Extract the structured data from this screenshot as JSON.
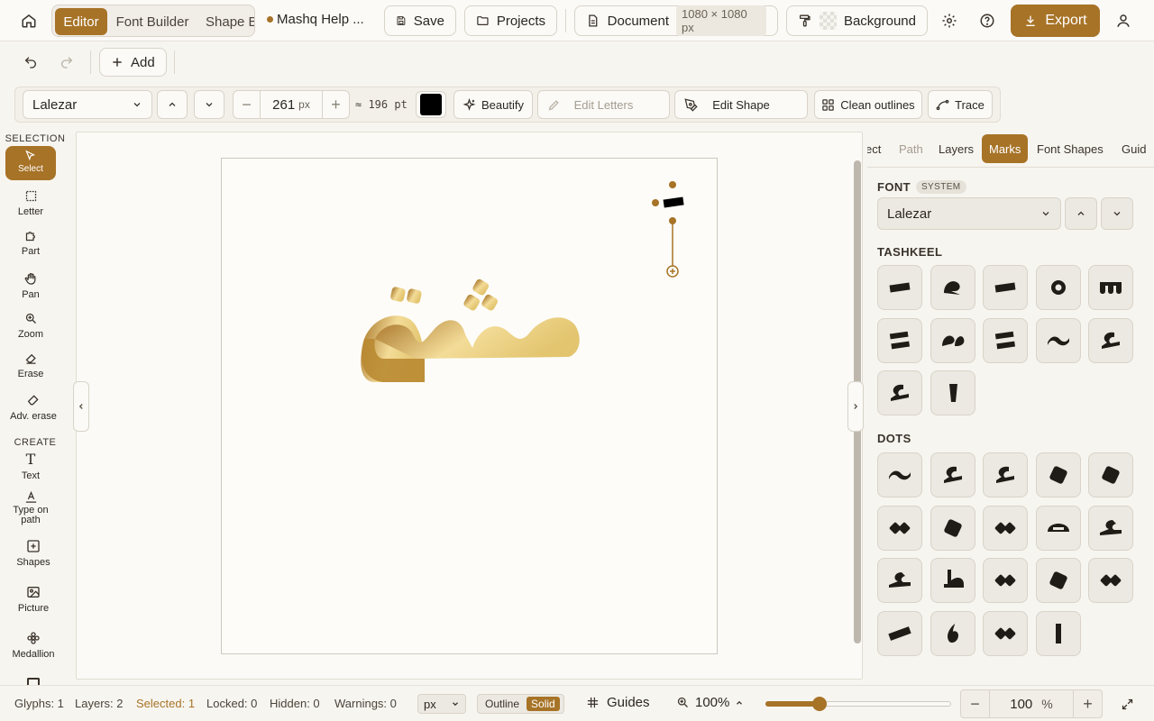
{
  "topbar": {
    "tabs": [
      {
        "label": "Editor"
      },
      {
        "label": "Font Builder"
      },
      {
        "label": "Shape Builder"
      }
    ],
    "help_label": "Mashq Help ...",
    "save_label": "Save",
    "projects_label": "Projects",
    "document_label": "Document",
    "document_size": "1080 × 1080 px",
    "background_label": "Background",
    "export_label": "Export"
  },
  "row2": {
    "add_label": "Add"
  },
  "toolbar": {
    "font_value": "Lalezar",
    "size_value": "261",
    "size_unit": "px",
    "size_pt": "≈ 196 pt",
    "color_value": "#000000",
    "beautify_label": "Beautify",
    "edit_letters_label": "Edit Letters",
    "edit_shape_label": "Edit Shape",
    "clean_outlines_label": "Clean outlines",
    "trace_label": "Trace"
  },
  "sidebar": {
    "selection_heading": "SELECTION",
    "create_heading": "CREATE",
    "tools": [
      {
        "label": "Select"
      },
      {
        "label": "Letter"
      },
      {
        "label": "Part"
      },
      {
        "label": "Pan"
      },
      {
        "label": "Zoom"
      },
      {
        "label": "Erase"
      },
      {
        "label": "Adv. erase"
      },
      {
        "label": "Text"
      },
      {
        "label": "Type on path"
      },
      {
        "label": "Shapes"
      },
      {
        "label": "Picture"
      },
      {
        "label": "Medallion"
      }
    ]
  },
  "canvas": {
    "artwork_text": "مشق",
    "gradient_colors": [
      "#a77327",
      "#f3dc98"
    ],
    "guide_color": "#a77327"
  },
  "rpanel": {
    "tabs": [
      {
        "label": "ect"
      },
      {
        "label": "Path"
      },
      {
        "label": "Layers"
      },
      {
        "label": "Marks"
      },
      {
        "label": "Font Shapes"
      },
      {
        "label": "Guid"
      }
    ],
    "font_heading": "FONT",
    "font_badge": "SYSTEM",
    "font_value": "Lalezar",
    "tashkeel_heading": "TASHKEEL",
    "tashkeel_marks": [
      "fatha",
      "damma-like",
      "fatha",
      "sukun",
      "shadda",
      "fathatan",
      "dammatan",
      "fathatan",
      "tilde",
      "hamza",
      "hamza",
      "alif"
    ],
    "dots_heading": "DOTS",
    "dot_marks": [
      "tilde",
      "hamza",
      "hamza",
      "diamond",
      "diamond",
      "double-dot",
      "diamond",
      "double-dot",
      "loop",
      "ayn",
      "ayn",
      "ta",
      "double-dot",
      "diamond",
      "double-dot",
      "slash",
      "drop",
      "double-dot",
      "bar"
    ]
  },
  "status": {
    "glyphs": "Glyphs: 1",
    "layers": "Layers: 2",
    "selected": "Selected: 1",
    "locked": "Locked: 0",
    "hidden": "Hidden: 0",
    "warnings": "Warnings: 0",
    "unit": "px",
    "outline_label": "Outline",
    "solid_label": "Solid",
    "guides_label": "Guides",
    "zoom_display": "100%",
    "zoom_slider_fraction": 0.29,
    "zoom_input": "100",
    "zoom_unit": "%"
  },
  "accent": "#a77327"
}
